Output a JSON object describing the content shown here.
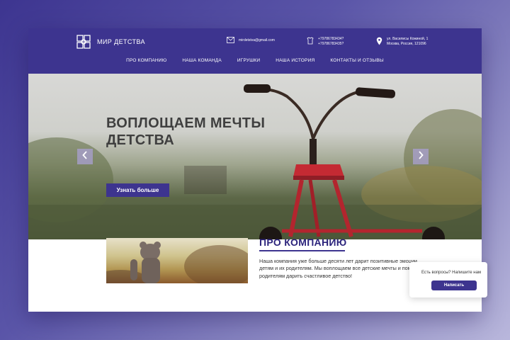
{
  "header": {
    "logo_text": "МИР ДЕТСТВА",
    "email": "mirdetstva@gmail.com",
    "phone_1": "+79786783434?",
    "phone_2": "+79786783435?",
    "address_line_1": "ул. Василисы Кожиной, 1",
    "address_line_2": "Москва, Россия, 121096"
  },
  "nav": {
    "items": [
      {
        "label": "ПРО КОМПАНИЮ"
      },
      {
        "label": "НАША КОМАНДА"
      },
      {
        "label": "ИГРУШКИ"
      },
      {
        "label": "НАША ИСТОРИЯ"
      },
      {
        "label": "КОНТАКТЫ И ОТЗЫВЫ"
      }
    ]
  },
  "hero": {
    "title": "ВОПЛОЩАЕМ МЕЧТЫ\nДЕТСТВА",
    "button_label": "Узнать больше"
  },
  "about": {
    "title": "ПРО КОМПАНИЮ",
    "text": "Наша компания уже больше десяти лет дарит позитивные эмоции детям и их родителям. Мы воплощаем все детские мечты и помогаем родителям дарить счастливое детство!"
  },
  "chat": {
    "prompt": "Есть вопросы? Напишите нам",
    "button_label": "Написать"
  },
  "colors": {
    "brand": "#3d348f",
    "page_background": "#5a55a8",
    "title_text": "#2b237b"
  },
  "icons": [
    "logo-icon",
    "email-icon",
    "phone-icon",
    "location-icon",
    "chevron-left-icon",
    "chevron-right-icon"
  ]
}
